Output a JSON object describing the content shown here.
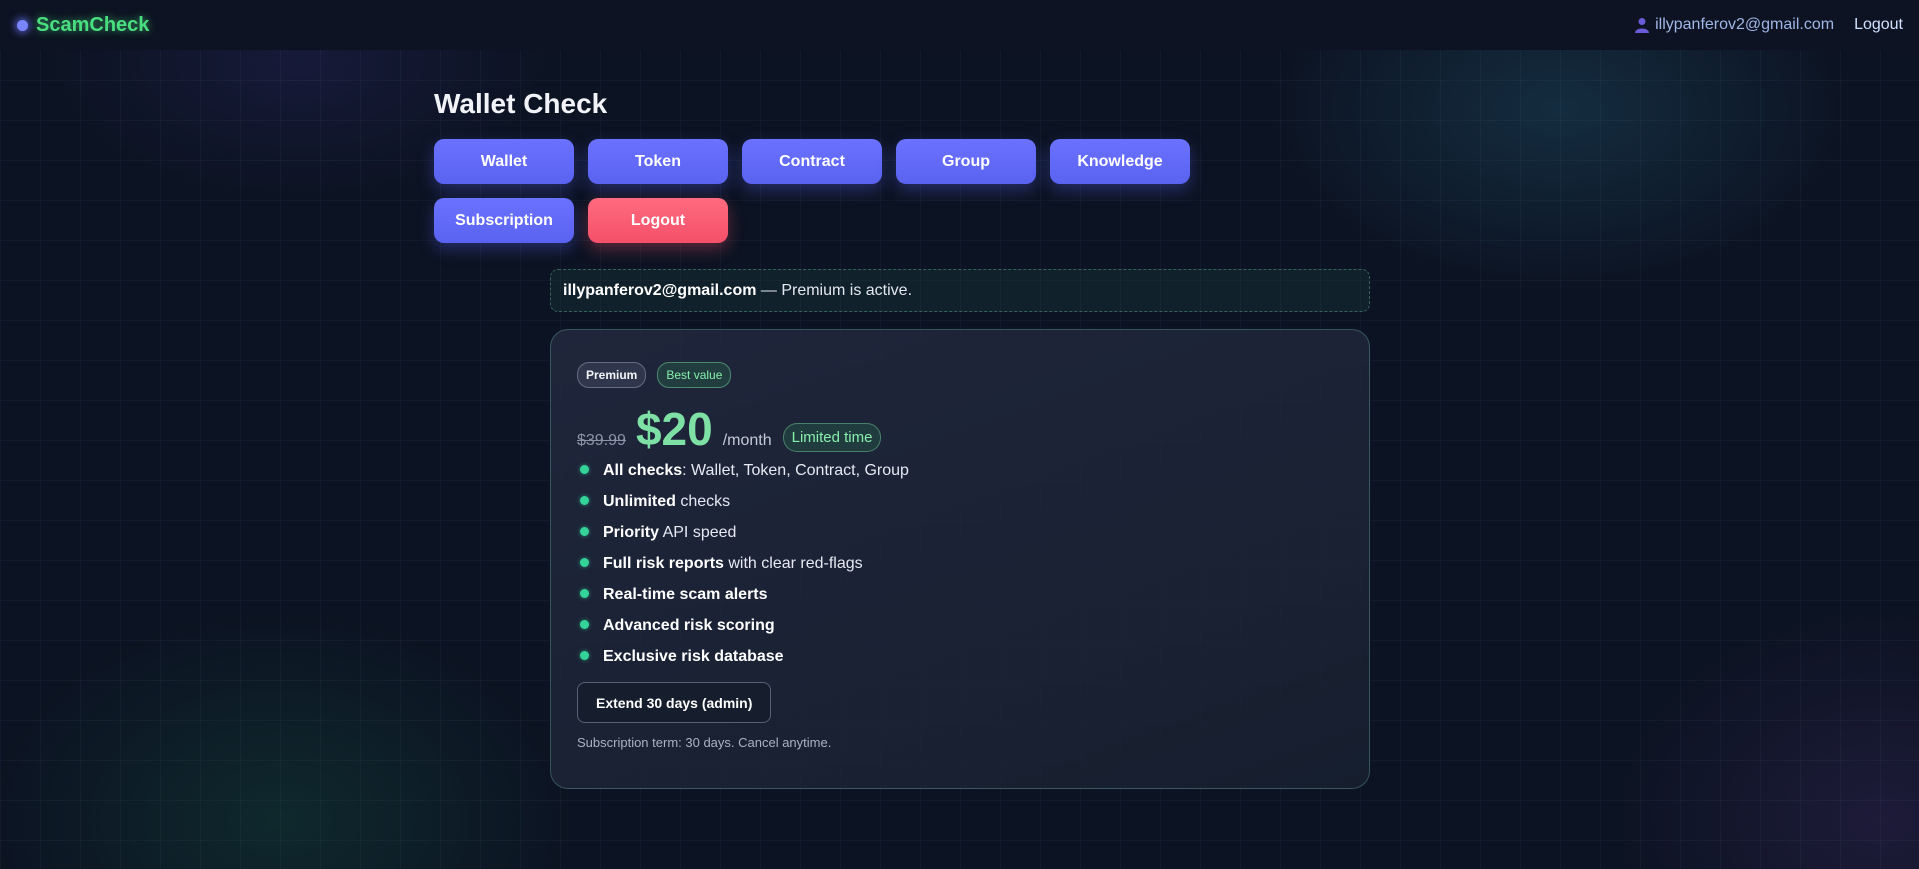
{
  "brand": {
    "name": "ScamCheck"
  },
  "header": {
    "user_email": "illypanferov2@gmail.com",
    "logout_label": "Logout"
  },
  "page": {
    "title": "Wallet Check"
  },
  "nav": {
    "items": [
      {
        "label": "Wallet"
      },
      {
        "label": "Token"
      },
      {
        "label": "Contract"
      },
      {
        "label": "Group"
      },
      {
        "label": "Knowledge"
      },
      {
        "label": "Subscription"
      }
    ],
    "logout_label": "Logout"
  },
  "status": {
    "email": "illypanferov2@gmail.com",
    "message": " — Premium is active."
  },
  "plan": {
    "badge_premium": "Premium",
    "badge_best": "Best value",
    "old_price": "$39.99",
    "price": "$20",
    "per": "/month",
    "limited": "Limited time",
    "features": [
      {
        "strong": "All checks",
        "rest": ": Wallet, Token, Contract, Group"
      },
      {
        "strong": "Unlimited",
        "rest": " checks"
      },
      {
        "strong": "Priority",
        "rest": " API speed"
      },
      {
        "strong": "Full risk reports",
        "rest": " with clear red-flags"
      },
      {
        "strong": "Real-time scam alerts",
        "rest": ""
      },
      {
        "strong": "Advanced risk scoring",
        "rest": ""
      },
      {
        "strong": "Exclusive risk database",
        "rest": ""
      }
    ],
    "extend_label": "Extend 30 days (admin)",
    "term": "Subscription term: 30 days. Cancel anytime."
  },
  "colors": {
    "brand_green": "#4ade80",
    "nav_button": "#6b72ff",
    "logout_button": "#f4506a",
    "price_green": "#7ee0a4"
  }
}
